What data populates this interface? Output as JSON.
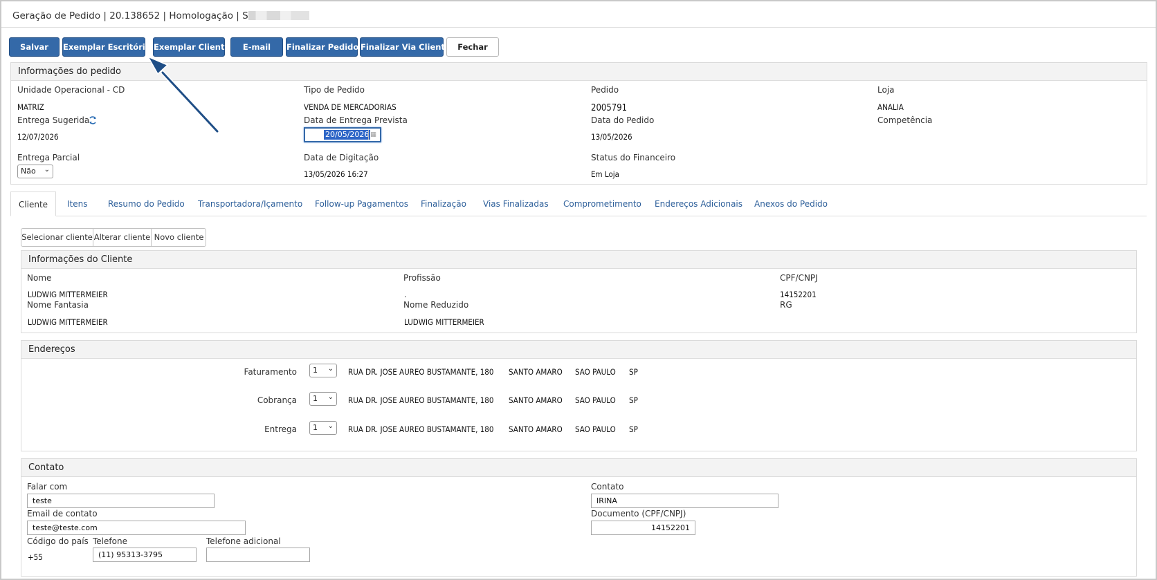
{
  "window": {
    "title": "Geração de Pedido | 20.138652 | Homologação | S"
  },
  "toolbar": {
    "buttons": [
      {
        "label": "Salvar"
      },
      {
        "label": "Exemplar Escritório"
      },
      {
        "label": "Exemplar Cliente"
      },
      {
        "label": "E-mail"
      },
      {
        "label": "Finalizar Pedido"
      },
      {
        "label": "Finalizar Via Cliente"
      },
      {
        "label": "Fechar"
      }
    ]
  },
  "order_info": {
    "header": "Informações do pedido",
    "unidade_label": "Unidade Operacional - CD",
    "unidade_value": "MATRIZ",
    "tipo_label": "Tipo de Pedido",
    "tipo_value": "VENDA DE MERCADORIAS",
    "pedido_label": "Pedido",
    "pedido_value": "2005791",
    "loja_label": "Loja",
    "loja_value": "ANALIA",
    "entrega_sugerida_label": "Entrega Sugerida",
    "entrega_sugerida_value": "12/07/2026",
    "entrega_prevista_label": "Data de Entrega Prevista",
    "entrega_prevista_value": "20/05/2026",
    "data_pedido_label": "Data do Pedido",
    "data_pedido_value": "13/05/2026",
    "competencia_label": "Competência",
    "entrega_parcial_label": "Entrega Parcial",
    "entrega_parcial_value": "Não",
    "digitacao_label": "Data de Digitação",
    "digitacao_value": "13/05/2026 16:27",
    "status_fin_label": "Status do Financeiro",
    "status_fin_value": "Em Loja"
  },
  "tabs": [
    {
      "label": "Cliente"
    },
    {
      "label": "Itens"
    },
    {
      "label": "Resumo do Pedido"
    },
    {
      "label": "Transportadora/Içamento"
    },
    {
      "label": "Follow-up Pagamentos"
    },
    {
      "label": "Finalização"
    },
    {
      "label": "Vias Finalizadas"
    },
    {
      "label": "Comprometimento"
    },
    {
      "label": "Endereços Adicionais"
    },
    {
      "label": "Anexos do Pedido"
    }
  ],
  "client_actions": [
    {
      "label": "Selecionar cliente"
    },
    {
      "label": "Alterar cliente"
    },
    {
      "label": "Novo cliente"
    }
  ],
  "client_info": {
    "header": "Informações do Cliente",
    "nome_label": "Nome",
    "nome_value": "LUDWIG MITTERMEIER",
    "profissao_label": "Profissão",
    "profissao_value": ".",
    "cpf_label": "CPF/CNPJ",
    "cpf_value": "14152201",
    "fantasia_label": "Nome Fantasia",
    "fantasia_value": "LUDWIG MITTERMEIER",
    "reduzido_label": "Nome Reduzido",
    "reduzido_value": "LUDWIG MITTERMEIER",
    "rg_label": "RG"
  },
  "addresses": {
    "header": "Endereços",
    "rows": [
      {
        "label": "Faturamento",
        "select": "1",
        "street": "RUA DR. JOSE AUREO BUSTAMANTE, 180",
        "district": "SANTO AMARO",
        "city": "SAO PAULO",
        "state": "SP"
      },
      {
        "label": "Cobrança",
        "select": "1",
        "street": "RUA DR. JOSE AUREO BUSTAMANTE, 180",
        "district": "SANTO AMARO",
        "city": "SAO PAULO",
        "state": "SP"
      },
      {
        "label": "Entrega",
        "select": "1",
        "street": "RUA DR. JOSE AUREO BUSTAMANTE, 180",
        "district": "SANTO AMARO",
        "city": "SAO PAULO",
        "state": "SP"
      }
    ]
  },
  "contact": {
    "header": "Contato",
    "falar_label": "Falar com",
    "falar_value": "teste",
    "contato_label": "Contato",
    "contato_value": "IRINA",
    "email_label": "Email de contato",
    "email_value": "teste@teste.com",
    "documento_label": "Documento (CPF/CNPJ)",
    "documento_value": "14152201",
    "pais_label": "Código do país",
    "pais_value": "+55",
    "telefone_label": "Telefone",
    "telefone_value": "(11) 95313-3795",
    "tel_adicional_label": "Telefone adicional",
    "tel_adicional_value": ""
  },
  "icons": {
    "refresh": "refresh-icon",
    "calendar": "calendar-icon",
    "arrow": "pointer-arrow-annotation"
  },
  "colors": {
    "primary_button": "#3469a8",
    "tab_link": "#2d5f9a",
    "annotation_arrow": "#1f4e86"
  }
}
